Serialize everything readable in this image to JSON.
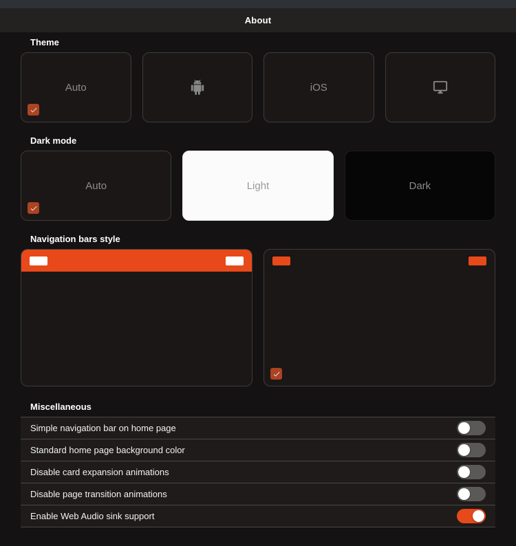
{
  "header": {
    "title": "About"
  },
  "colors": {
    "accent": "#e8491a",
    "checkbox": "#ac4323",
    "toggle_off": "#5b5957"
  },
  "sections": {
    "theme": {
      "label": "Theme",
      "options": [
        {
          "label": "Auto",
          "selected": true
        },
        {
          "icon": "android-icon",
          "selected": false
        },
        {
          "label": "iOS",
          "selected": false
        },
        {
          "icon": "desktop-icon",
          "selected": false
        }
      ]
    },
    "dark_mode": {
      "label": "Dark mode",
      "options": [
        {
          "label": "Auto",
          "selected": true
        },
        {
          "label": "Light",
          "selected": false
        },
        {
          "label": "Dark",
          "selected": false
        }
      ]
    },
    "nav_bars": {
      "label": "Navigation bars style",
      "options": [
        {
          "style": "solid-accent-bar",
          "selected": false
        },
        {
          "style": "transparent-bar",
          "selected": true
        }
      ]
    },
    "misc": {
      "label": "Miscellaneous",
      "rows": [
        {
          "label": "Simple navigation bar on home page",
          "enabled": false
        },
        {
          "label": "Standard home page background color",
          "enabled": false
        },
        {
          "label": "Disable card expansion animations",
          "enabled": false
        },
        {
          "label": "Disable page transition animations",
          "enabled": false
        },
        {
          "label": "Enable Web Audio sink support",
          "enabled": true
        }
      ]
    }
  }
}
